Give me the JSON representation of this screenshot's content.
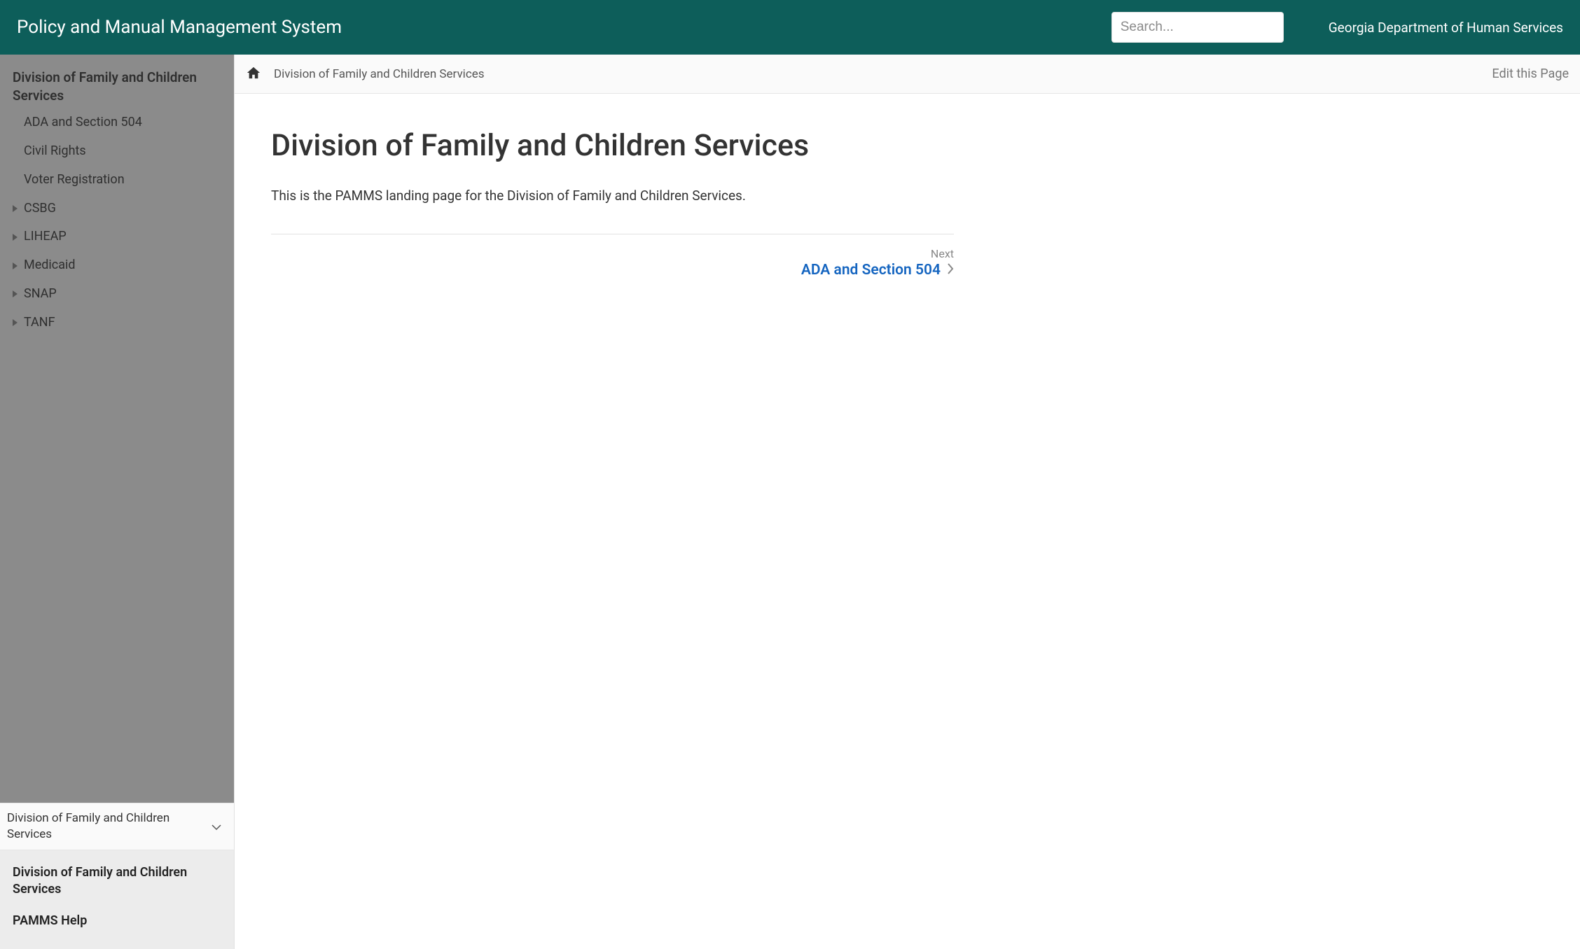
{
  "header": {
    "title": "Policy and Manual Management System",
    "org": "Georgia Department of Human Services",
    "search_placeholder": "Search..."
  },
  "sidebar": {
    "heading": "Division of Family and Children Services",
    "items": [
      {
        "label": "ADA and Section 504",
        "has_children": false
      },
      {
        "label": "Civil Rights",
        "has_children": false
      },
      {
        "label": "Voter Registration",
        "has_children": false
      },
      {
        "label": "CSBG",
        "has_children": true
      },
      {
        "label": "LIHEAP",
        "has_children": true
      },
      {
        "label": "Medicaid",
        "has_children": true
      },
      {
        "label": "SNAP",
        "has_children": true
      },
      {
        "label": "TANF",
        "has_children": true
      }
    ],
    "dropdown": "Division of Family and Children Services",
    "bottom_items": [
      "Division of Family and Children Services",
      "PAMMS Help"
    ]
  },
  "breadcrumb": {
    "current": "Division of Family and Children Services",
    "edit": "Edit this Page"
  },
  "main": {
    "title": "Division of Family and Children Services",
    "body": "This is the PAMMS landing page for the Division of Family and Children Services."
  },
  "next_nav": {
    "label": "Next",
    "target": "ADA and Section 504"
  }
}
